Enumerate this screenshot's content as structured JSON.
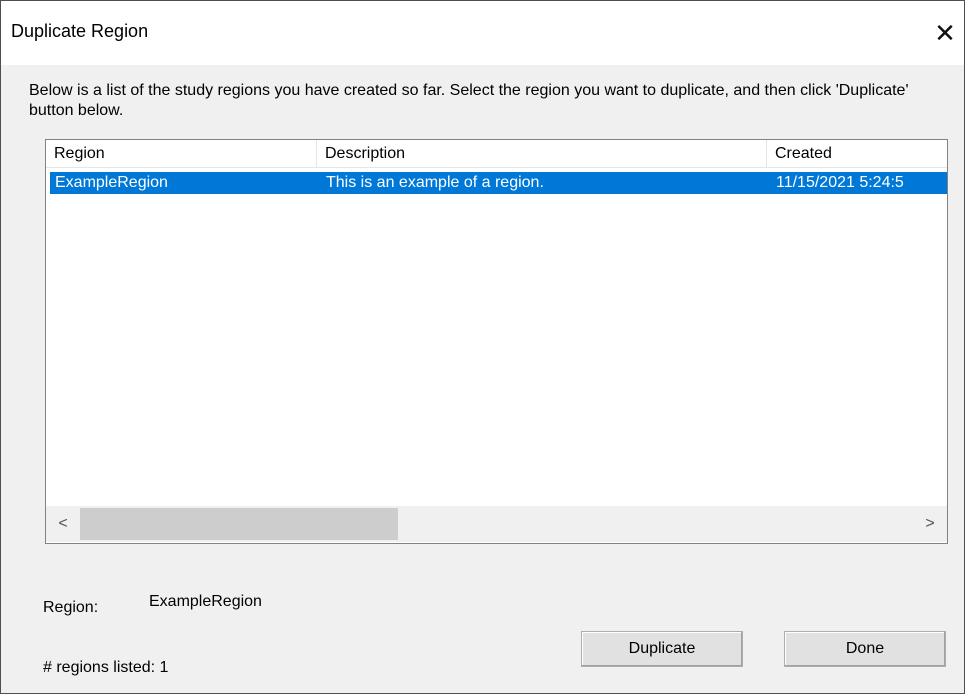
{
  "window": {
    "title": "Duplicate Region",
    "close_glyph": "✕"
  },
  "instructions": "Below is a list of the study regions you have created so far.  Select the region you want to duplicate, and then click 'Duplicate' button below.",
  "table": {
    "columns": [
      "Region",
      "Description",
      "Created"
    ],
    "rows": [
      {
        "region": "ExampleRegion",
        "description": "This is an example of a region.",
        "created": "11/15/2021 5:24:5"
      }
    ]
  },
  "scrollbar": {
    "left_arrow": "<",
    "right_arrow": ">"
  },
  "selection": {
    "label": "Region:",
    "value": "ExampleRegion"
  },
  "status": {
    "count_text": "# regions listed: 1"
  },
  "buttons": {
    "duplicate": "Duplicate",
    "done": "Done"
  },
  "colors": {
    "selection_bg": "#0078d7",
    "dialog_bg": "#f0f0f0"
  }
}
